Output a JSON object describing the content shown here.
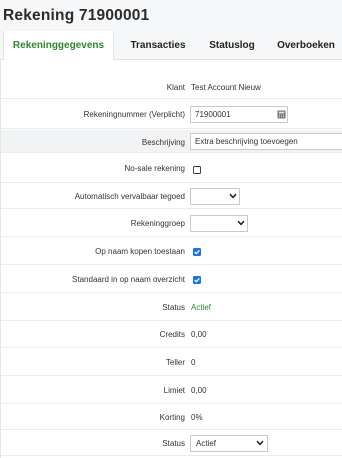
{
  "page": {
    "title": "Rekening 71900001"
  },
  "tabs": [
    {
      "label": "Rekeninggegevens",
      "active": true
    },
    {
      "label": "Transacties",
      "active": false
    },
    {
      "label": "Statuslog",
      "active": false
    },
    {
      "label": "Overboeken",
      "active": false
    }
  ],
  "form": {
    "klant": {
      "label": "Klant",
      "value": "Test Account Nieuw"
    },
    "rekeningnummer": {
      "label": "Rekeningnummer (Verplicht)",
      "value": "71900001",
      "icon": "calculator-icon"
    },
    "beschrijving": {
      "label": "Beschrijving",
      "value": "Extra beschrijving toevoegen"
    },
    "no_sale": {
      "label": "No-sale rekening",
      "checked": false
    },
    "automatisch": {
      "label": "Automatisch vervalbaar tegoed",
      "value": ""
    },
    "rekeninggroep": {
      "label": "Rekeninggroep",
      "value": ""
    },
    "op_naam_kopen": {
      "label": "Op naam kopen toestaan",
      "checked": true
    },
    "standaard_overzicht": {
      "label": "Standaard in op naam overzicht",
      "checked": true
    },
    "status_text": {
      "label": "Status",
      "value": "Actief"
    },
    "credits": {
      "label": "Credits",
      "value": "0,00"
    },
    "teller": {
      "label": "Teller",
      "value": "0"
    },
    "limiet": {
      "label": "Limiet",
      "value": "0,00"
    },
    "korting": {
      "label": "Korting",
      "value": "0%"
    },
    "status_select": {
      "label": "Status",
      "value": "Actief"
    }
  },
  "colors": {
    "accent_green": "#2a8a2a",
    "checkbox_blue": "#1a73e8",
    "tab_bar_bg": "#f6f7f8"
  }
}
